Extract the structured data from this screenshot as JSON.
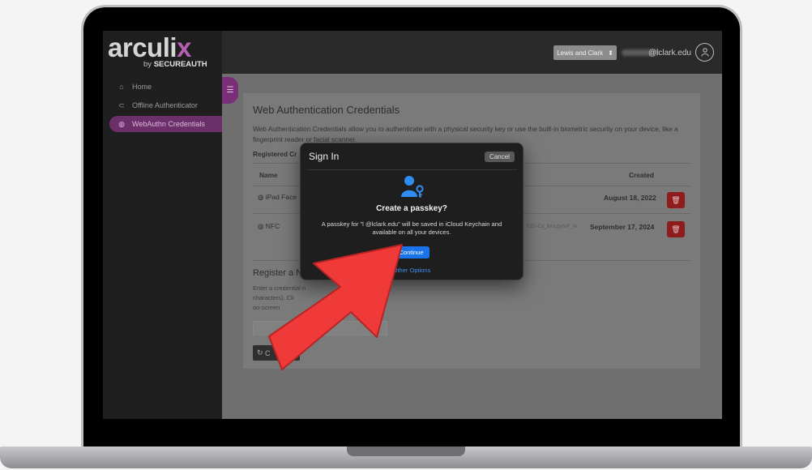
{
  "brand": {
    "logo_main": "arculi",
    "logo_x": "x",
    "logo_by": "by ",
    "logo_company": "SECUREAUTH"
  },
  "header": {
    "org_select_value": "Lewis and Clark",
    "email": "@lclark.edu"
  },
  "sidebar": {
    "items": [
      {
        "label": "Home",
        "icon": "home-icon"
      },
      {
        "label": "Offline Authenticator",
        "icon": "lock-icon"
      },
      {
        "label": "WebAuthn Credentials",
        "icon": "fingerprint-icon",
        "active": true
      }
    ]
  },
  "content": {
    "title": "Web Authentication Credentials",
    "description": "Web Authentication Credentials allow you to authenticate with a physical security key or use the built-in biometric security on your device, like a fingerprint reader or facial scanner.",
    "registered_label": "Registered Cr",
    "table": {
      "headers": {
        "name": "Name",
        "created": "Created"
      },
      "rows": [
        {
          "name": "iPad Face",
          "key": "",
          "created": "August 18, 2022"
        },
        {
          "name": "NFC",
          "key": "FZU-Cq_BmLgyhvF_lA",
          "created": "September 17, 2024"
        }
      ]
    },
    "register": {
      "title": "Register a N",
      "description_lines": [
        "Enter a credential n",
        "characters). Cli",
        "on-screen"
      ],
      "button_label": "C"
    }
  },
  "dialog": {
    "title": "Sign In",
    "cancel_label": "Cancel",
    "heading": "Create a passkey?",
    "body": "A passkey for \"l        @lclark.edu\" will be saved in iCloud Keychain and available on all your devices.",
    "continue_label": "Continue",
    "other_options_label": "Other Options"
  },
  "colors": {
    "accent_purple": "#b55fb1",
    "apple_blue": "#1a73e8",
    "delete_red": "#8f1c1c",
    "arrow_red": "#f03a3a"
  }
}
